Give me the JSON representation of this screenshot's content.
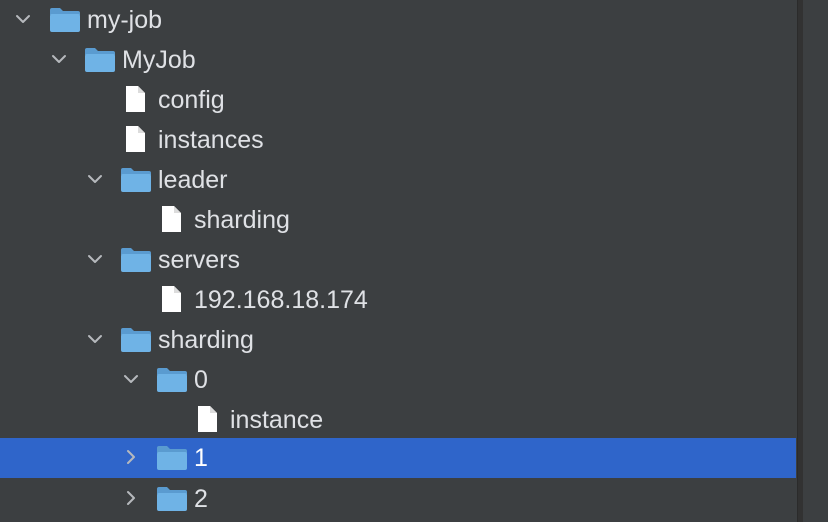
{
  "tree": {
    "rows": [
      {
        "label": "my-job",
        "type": "folder",
        "state": "expanded",
        "selected": false
      },
      {
        "label": "MyJob",
        "type": "folder",
        "state": "expanded",
        "selected": false
      },
      {
        "label": "config",
        "type": "file",
        "state": "leaf",
        "selected": false
      },
      {
        "label": "instances",
        "type": "file",
        "state": "leaf",
        "selected": false
      },
      {
        "label": "leader",
        "type": "folder",
        "state": "expanded",
        "selected": false
      },
      {
        "label": "sharding",
        "type": "file",
        "state": "leaf",
        "selected": false
      },
      {
        "label": "servers",
        "type": "folder",
        "state": "expanded",
        "selected": false
      },
      {
        "label": "192.168.18.174",
        "type": "file",
        "state": "leaf",
        "selected": false
      },
      {
        "label": "sharding",
        "type": "folder",
        "state": "expanded",
        "selected": false
      },
      {
        "label": "0",
        "type": "folder",
        "state": "expanded",
        "selected": false
      },
      {
        "label": "instance",
        "type": "file",
        "state": "leaf",
        "selected": false
      },
      {
        "label": "1",
        "type": "folder",
        "state": "collapsed",
        "selected": true
      },
      {
        "label": "2",
        "type": "folder",
        "state": "collapsed",
        "selected": false
      }
    ]
  },
  "colors": {
    "background": "#3c3f41",
    "selection": "#2f65ca",
    "text": "#dfe1e5",
    "folder": "#6fb3e6",
    "file": "#ffffff",
    "chevron": "#b6b9bd"
  },
  "icons": {
    "folder": "folder-icon",
    "file": "file-icon",
    "expanded": "chevron-down-icon",
    "collapsed": "chevron-right-icon"
  }
}
